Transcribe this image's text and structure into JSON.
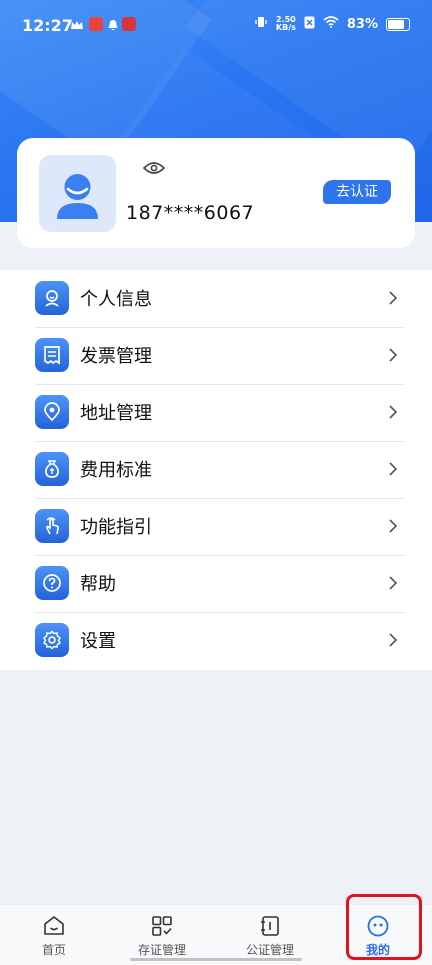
{
  "status_bar": {
    "time": "12:27",
    "net_speed_value": "2.50",
    "net_speed_unit": "KB/s",
    "battery": "83%"
  },
  "profile": {
    "phone": "187****6067",
    "verify_label": "去认证"
  },
  "menu": {
    "items": [
      {
        "label": "个人信息",
        "icon": "person-icon"
      },
      {
        "label": "发票管理",
        "icon": "invoice-icon"
      },
      {
        "label": "地址管理",
        "icon": "location-pin-icon"
      },
      {
        "label": "费用标准",
        "icon": "money-bag-icon"
      },
      {
        "label": "功能指引",
        "icon": "hand-pointer-icon"
      },
      {
        "label": "帮助",
        "icon": "question-icon"
      },
      {
        "label": "设置",
        "icon": "gear-icon"
      }
    ]
  },
  "tabbar": {
    "tabs": [
      {
        "label": "首页",
        "icon": "home-icon"
      },
      {
        "label": "存证管理",
        "icon": "grid-check-icon"
      },
      {
        "label": "公证管理",
        "icon": "notebook-icon"
      },
      {
        "label": "我的",
        "icon": "smiley-icon",
        "active": true
      }
    ]
  },
  "colors": {
    "primary": "#2a6de8",
    "highlight": "#e0141e"
  }
}
